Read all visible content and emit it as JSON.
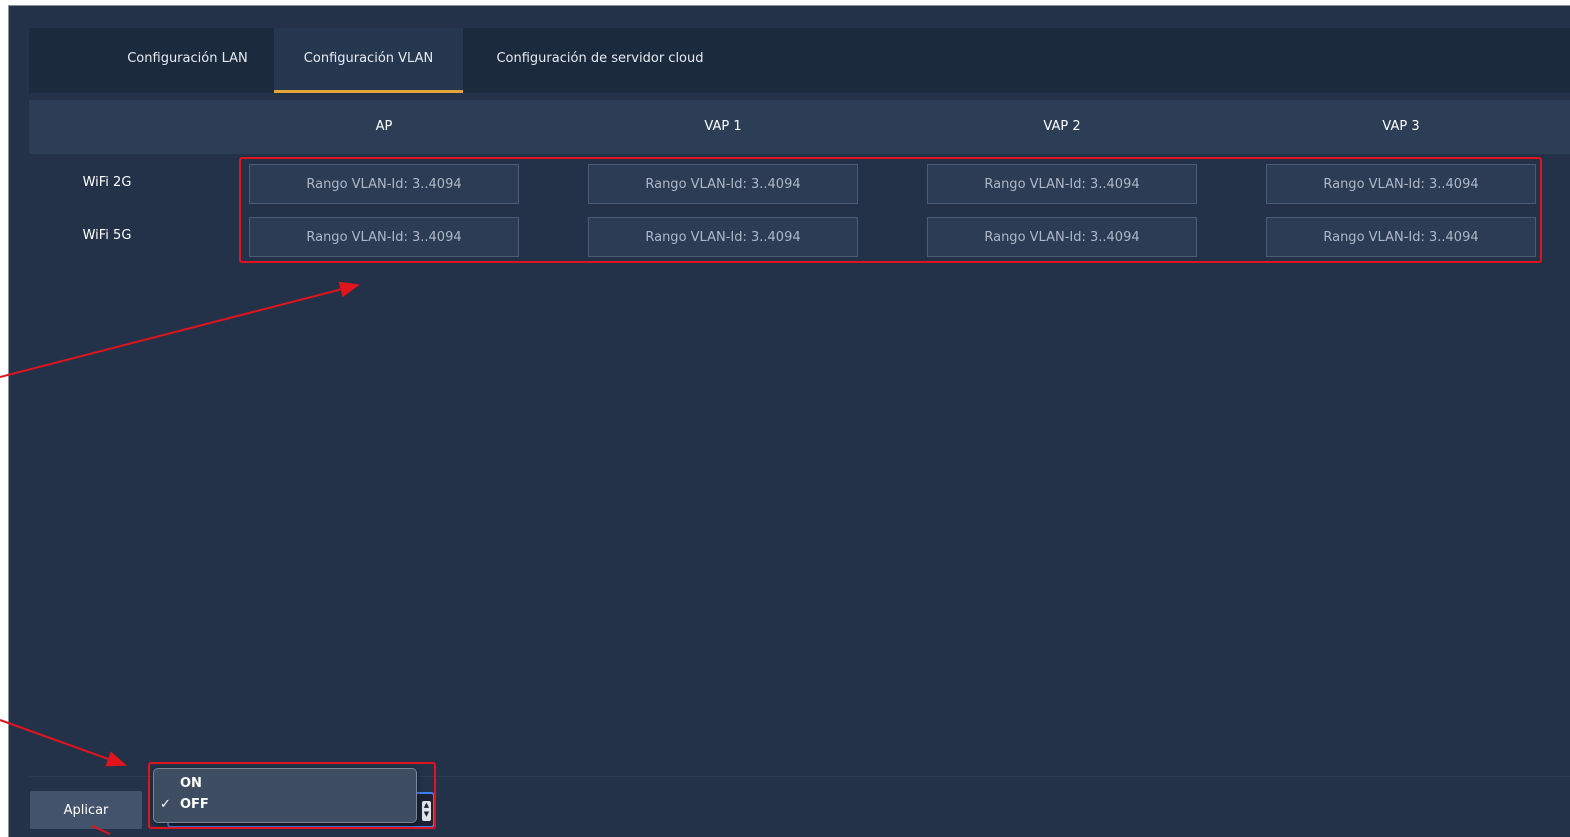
{
  "tabs": [
    {
      "label": "Configuración LAN"
    },
    {
      "label": "Configuración VLAN"
    },
    {
      "label": "Configuración de servidor cloud"
    }
  ],
  "active_tab": "Configuración VLAN",
  "columns": [
    "AP",
    "VAP 1",
    "VAP 2",
    "VAP 3"
  ],
  "rows": [
    {
      "label": "WiFi 2G"
    },
    {
      "label": "WiFi 5G"
    }
  ],
  "vlan_placeholder": "Rango VLAN-Id: 3..4094",
  "apply_label": "Aplicar",
  "select": {
    "options": [
      "ON",
      "OFF"
    ],
    "selected": "OFF",
    "checkmark": "✓"
  },
  "colors": {
    "background": "#233249",
    "active_tab_underline": "#e3a43a",
    "annotation_red": "#e0141c",
    "focus_blue": "#3d7ef2"
  }
}
